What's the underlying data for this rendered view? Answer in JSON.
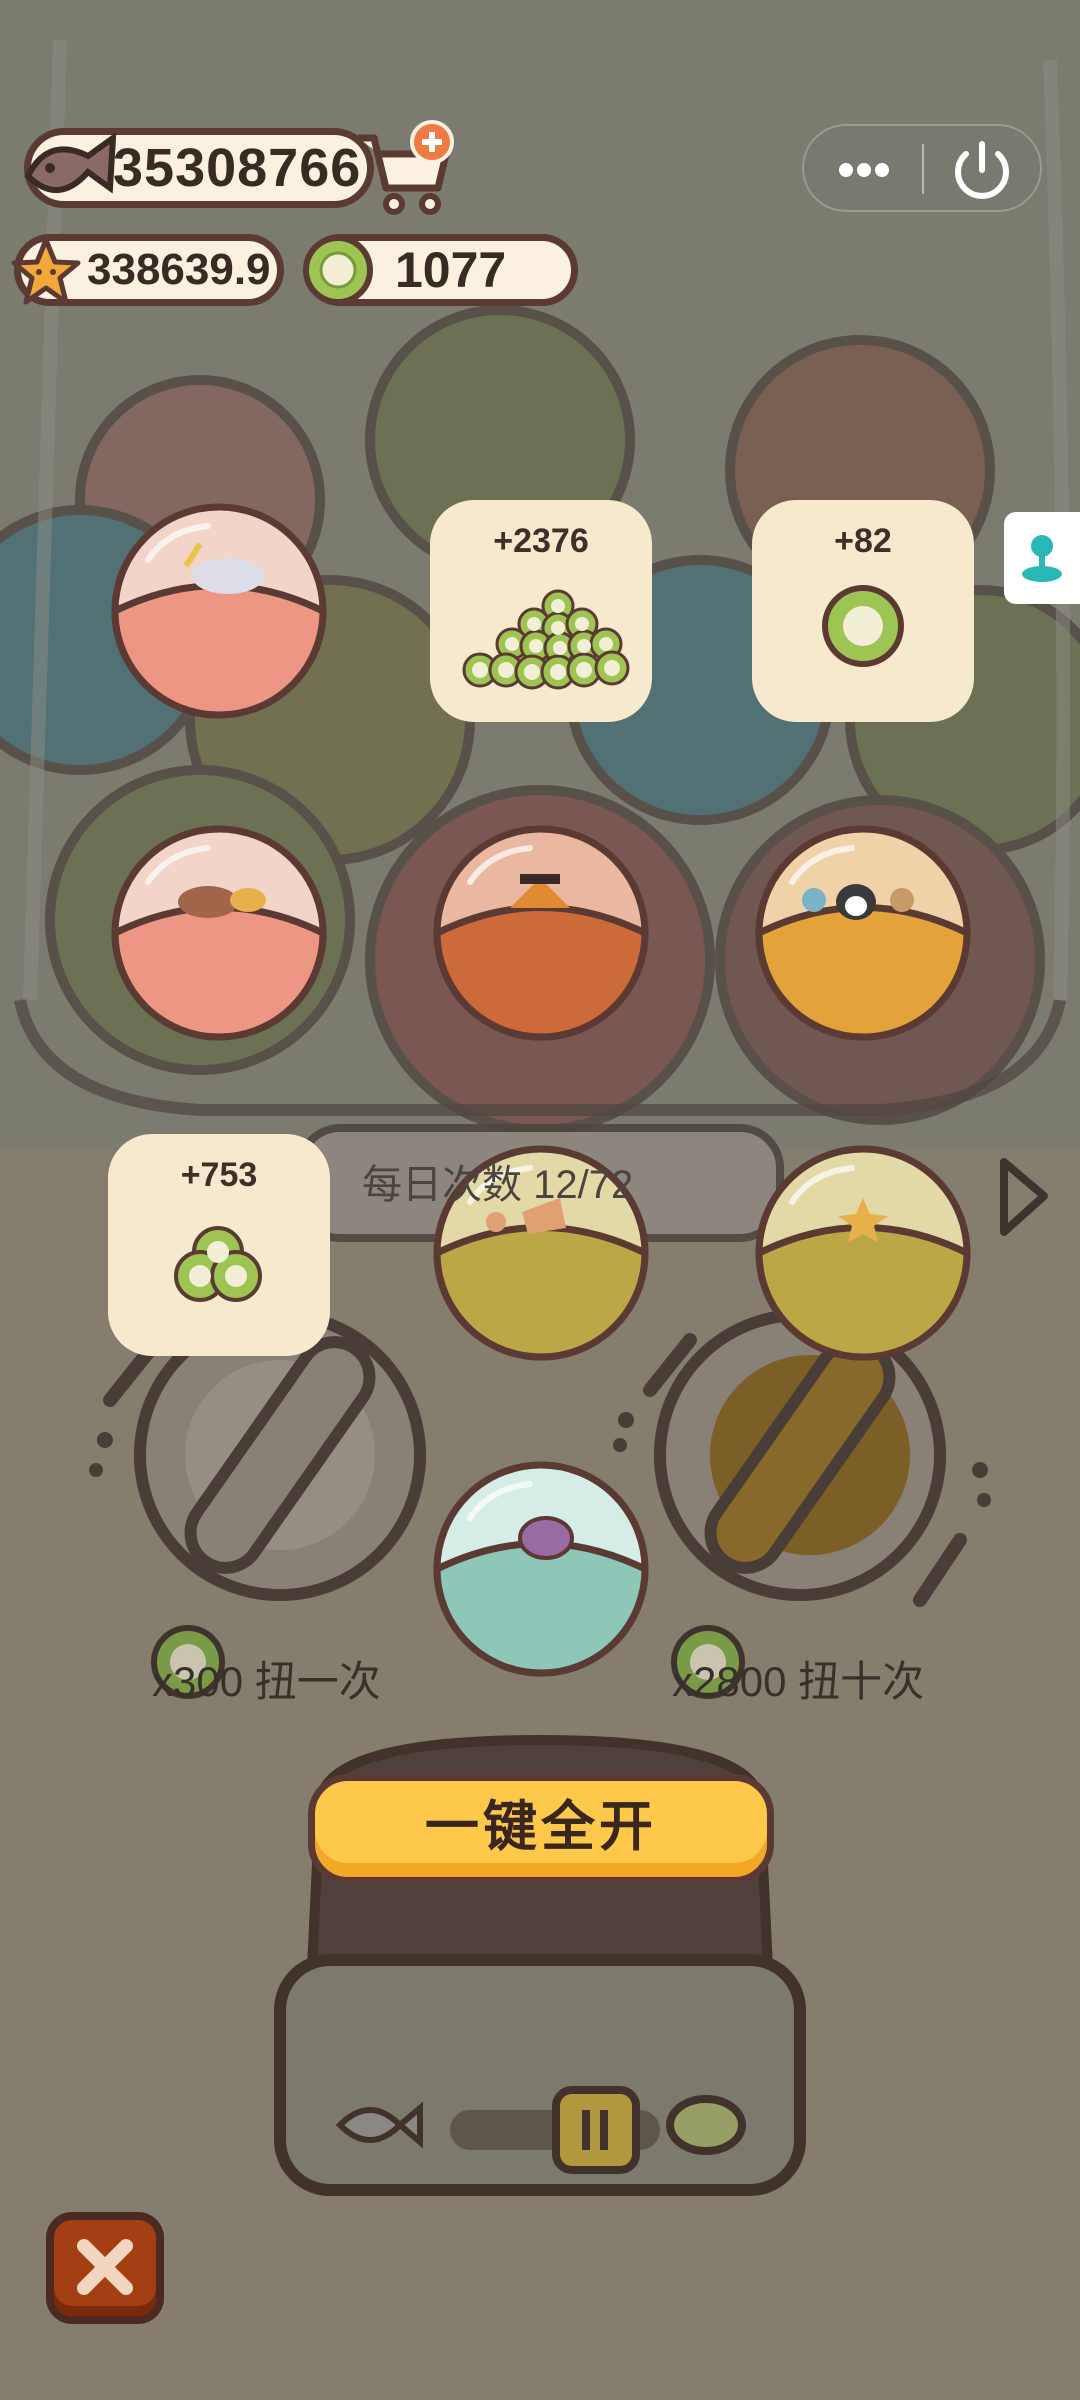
{
  "currencies": {
    "fish": "35308766",
    "stars": "338639.9",
    "coins": "1077"
  },
  "rewards": [
    {
      "amount": "+2376",
      "icon": "coin-pile-icon"
    },
    {
      "amount": "+82",
      "icon": "coin-icon"
    },
    {
      "amount": "+753",
      "icon": "coin-stack-icon"
    }
  ],
  "daily_count": "每日次数 12/72",
  "spin_one": {
    "cost": "x300 扭一次"
  },
  "spin_ten": {
    "cost": "x2800 扭十次"
  },
  "open_all_label": "一键全开",
  "capsules": [
    {
      "name": "capsule-pink-unicorn",
      "color": "#ec9683",
      "icon": "unicorn-icon"
    },
    {
      "name": "capsule-pink-cat",
      "color": "#ec9683",
      "icon": "cat-icon"
    },
    {
      "name": "capsule-orange-fox",
      "color": "#cc6a3a",
      "icon": "fox-icon"
    },
    {
      "name": "capsule-yellow-penguin",
      "color": "#e4a23b",
      "icon": "penguin-icon"
    },
    {
      "name": "capsule-olive-fish",
      "color": "#bba746",
      "icon": "fish-icon"
    },
    {
      "name": "capsule-olive-star",
      "color": "#bba746",
      "icon": "starfish-icon"
    },
    {
      "name": "capsule-teal-shell",
      "color": "#8ec7b7",
      "icon": "shell-icon"
    }
  ],
  "icons": {
    "fish": "fish-icon",
    "cart": "cart-plus-icon",
    "star": "star-icon",
    "coin": "coin-icon",
    "more": "more-dots-icon",
    "power": "power-icon",
    "side": "joystick-icon",
    "close": "close-icon",
    "next": "next-arrow-icon"
  }
}
